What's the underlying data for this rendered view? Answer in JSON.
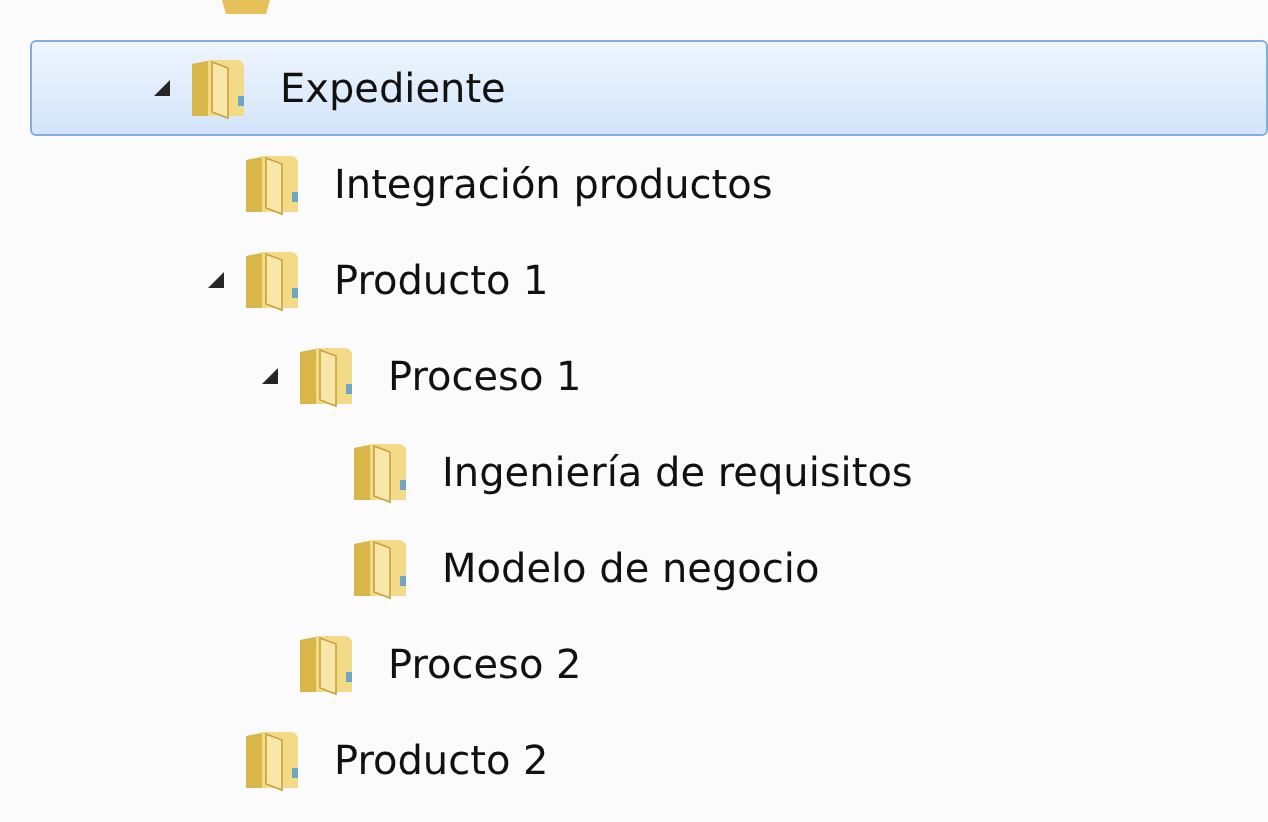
{
  "tree": [
    {
      "label": "Expediente",
      "selected": true,
      "expanded": true,
      "children": [
        {
          "label": "Integración productos",
          "selected": false
        },
        {
          "label": "Producto 1",
          "selected": false,
          "expanded": true,
          "children": [
            {
              "label": "Proceso 1",
              "selected": false,
              "expanded": true,
              "children": [
                {
                  "label": "Ingeniería de requisitos",
                  "selected": false
                },
                {
                  "label": "Modelo de negocio",
                  "selected": false
                }
              ]
            },
            {
              "label": "Proceso 2",
              "selected": false
            }
          ]
        },
        {
          "label": "Producto 2",
          "selected": false
        }
      ]
    }
  ]
}
